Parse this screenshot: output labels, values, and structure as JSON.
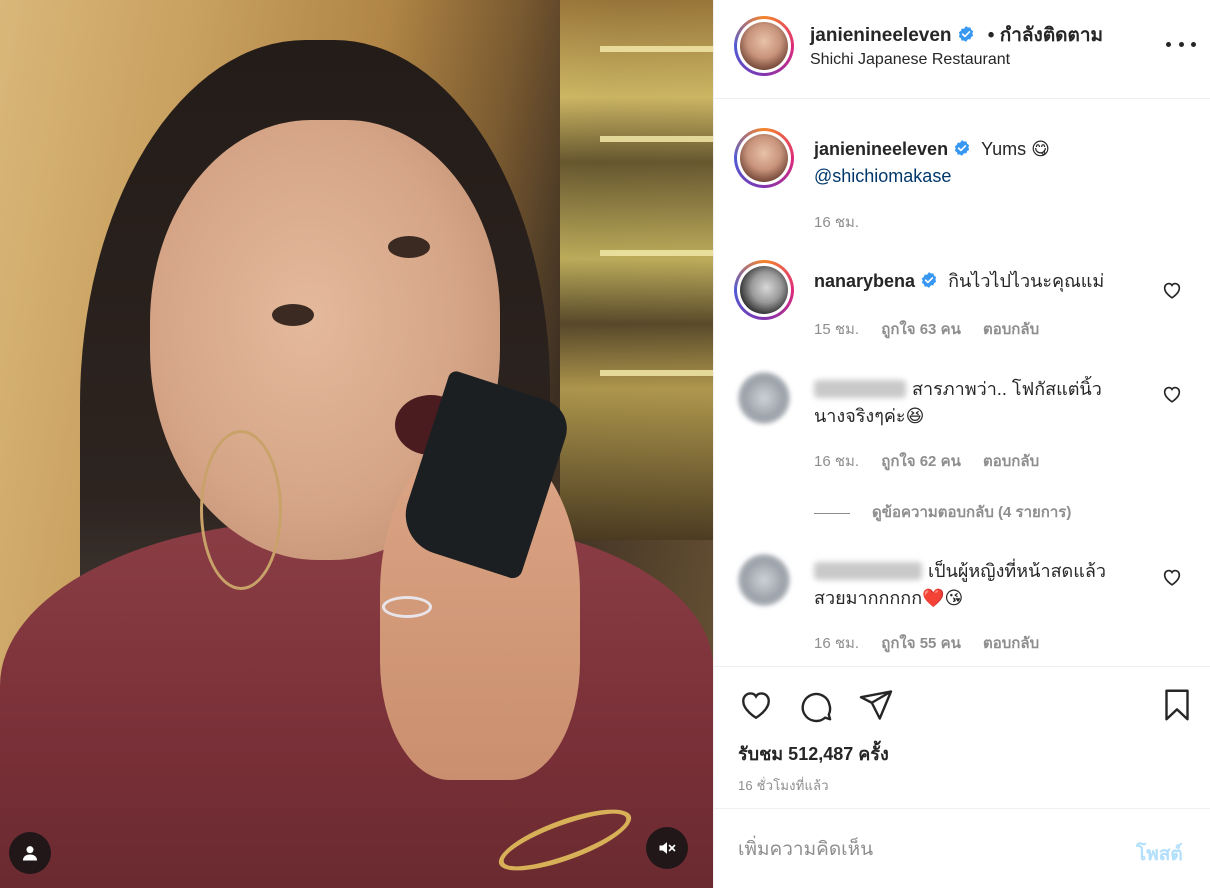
{
  "post": {
    "author": "janienineeleven",
    "follow_label": "• กำลังติดตาม",
    "location": "Shichi Japanese Restaurant",
    "more_icon": "more-options-icon",
    "verified_color": "#3897f0"
  },
  "caption": {
    "username": "janienineeleven",
    "text": "Yums 😋",
    "mention": "@shichiomakase",
    "time": "16 ชม."
  },
  "comments": [
    {
      "username": "nanarybena",
      "text": "กินไวไปไวนะคุณแม่",
      "time": "15 ชม.",
      "likes": "ถูกใจ 63 คน",
      "reply": "ตอบกลับ"
    },
    {
      "text_line1": "สารภาพว่า.. โฟกัสแต่นิ้ว",
      "text_line2": "นางจริงๆค่ะ😆",
      "time": "16 ชม.",
      "likes": "ถูกใจ 62 คน",
      "reply": "ตอบกลับ",
      "view_replies": "ดูข้อความตอบกลับ (4 รายการ)"
    },
    {
      "text_line1": "เป็นผู้หญิงที่หน้าสดแล้ว",
      "text_line2": "สวยมากกกกก❤️😘",
      "time": "16 ชม.",
      "likes": "ถูกใจ 55 คน",
      "reply": "ตอบกลับ"
    }
  ],
  "stats": {
    "views": "รับชม 512,487 ครั้ง",
    "time_ago": "16 ชั่วโมงที่แล้ว"
  },
  "composer": {
    "placeholder": "เพิ่มความคิดเห็น",
    "post_label": "โพสต์"
  },
  "colors": {
    "link": "#00376b",
    "muted": "#8e8e8e",
    "post_disabled": "#b2dffc"
  }
}
